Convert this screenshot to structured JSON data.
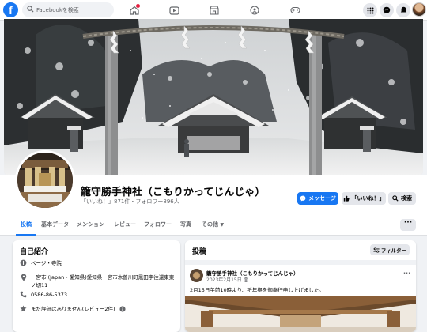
{
  "topbar": {
    "logo": "f",
    "search_placeholder": "Facebookを検索",
    "nav_icons": [
      "home-icon",
      "video-icon",
      "marketplace-icon",
      "groups-icon",
      "gaming-icon"
    ],
    "right_icons": [
      "menu-grid-icon",
      "messenger-icon",
      "notifications-icon"
    ]
  },
  "page": {
    "name": "籠守勝手神社（こもりかってじんじゃ）",
    "stats": "「いいね！」871件・フォロワー896人"
  },
  "actions": {
    "message": "メッセージ",
    "like": "「いいね！」",
    "search": "検索"
  },
  "tabs": [
    {
      "label": "投稿",
      "active": true
    },
    {
      "label": "基本データ"
    },
    {
      "label": "メンション"
    },
    {
      "label": "レビュー"
    },
    {
      "label": "フォロワー"
    },
    {
      "label": "写真"
    },
    {
      "label": "その他"
    }
  ],
  "more_button": "···",
  "intro": {
    "title": "自己紹介",
    "category": "ページ・寺院",
    "address": "一宮市 (Japan・愛知県)愛知県一宮市木曽川町黒田字往還東東ノ切11",
    "phone": "0586-86-5373",
    "rating": "まだ評価はありません(レビュー2件)"
  },
  "posts": {
    "title": "投稿",
    "filter": "フィルター",
    "author": "籠守勝手神社（こもりかってじんじゃ）",
    "date": "2023年2月15日",
    "text": "2月15日午前10時より、祈年祭を御奉行申し上げました。",
    "menu": "···"
  },
  "colors": {
    "brand": "#1877f2",
    "background": "#f0f2f5",
    "secondary_text": "#65676b",
    "button_grey": "#e4e6eb"
  }
}
